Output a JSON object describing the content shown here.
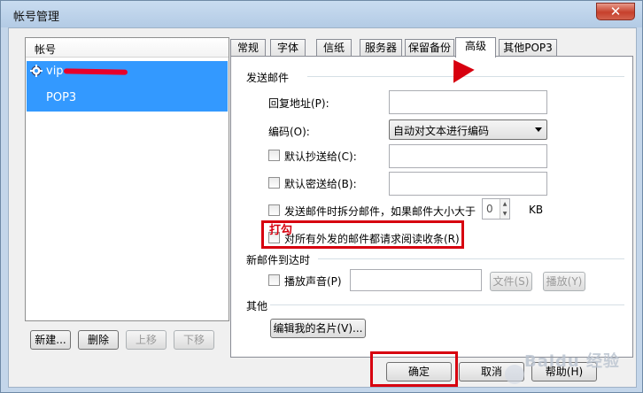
{
  "window": {
    "title": "帐号管理",
    "close_label": "✕"
  },
  "accounts": {
    "header": "帐号",
    "items": [
      {
        "name": "vip",
        "protocol": "POP3"
      }
    ]
  },
  "left_buttons": {
    "new": "新建...",
    "delete": "删除",
    "move_up": "上移",
    "move_down": "下移"
  },
  "tabs": [
    {
      "label": "常规"
    },
    {
      "label": "字体"
    },
    {
      "label": "信纸"
    },
    {
      "label": "服务器"
    },
    {
      "label": "保留备份"
    },
    {
      "label": "高级",
      "selected": true
    },
    {
      "label": "其他POP3"
    }
  ],
  "send": {
    "section": "发送邮件",
    "reply_label": "回复地址(P):",
    "reply_value": "",
    "encoding_label": "编码(O):",
    "encoding_value": "自动对文本进行编码",
    "cc_label": "默认抄送给(C):",
    "cc_value": "",
    "bcc_label": "默认密送给(B):",
    "bcc_value": "",
    "split_label": "发送邮件时拆分邮件，如果邮件大小大于",
    "split_value": "0",
    "split_unit": "KB",
    "receipt_label": "对所有外发的邮件都请求阅读收条(R)"
  },
  "annotation": "打勾",
  "arrival": {
    "section": "新邮件到达时",
    "sound_label": "播放声音(P)",
    "sound_value": "",
    "file_btn": "文件(S)",
    "play_btn": "播放(Y)"
  },
  "other": {
    "section": "其他",
    "edit_card_btn": "编辑我的名片(V)..."
  },
  "footer": {
    "ok": "确定",
    "cancel": "取消",
    "help": "帮助(H)"
  },
  "watermark": "Baidu 经验",
  "colors": {
    "selection": "#3399ff",
    "highlight": "#d7000f"
  }
}
